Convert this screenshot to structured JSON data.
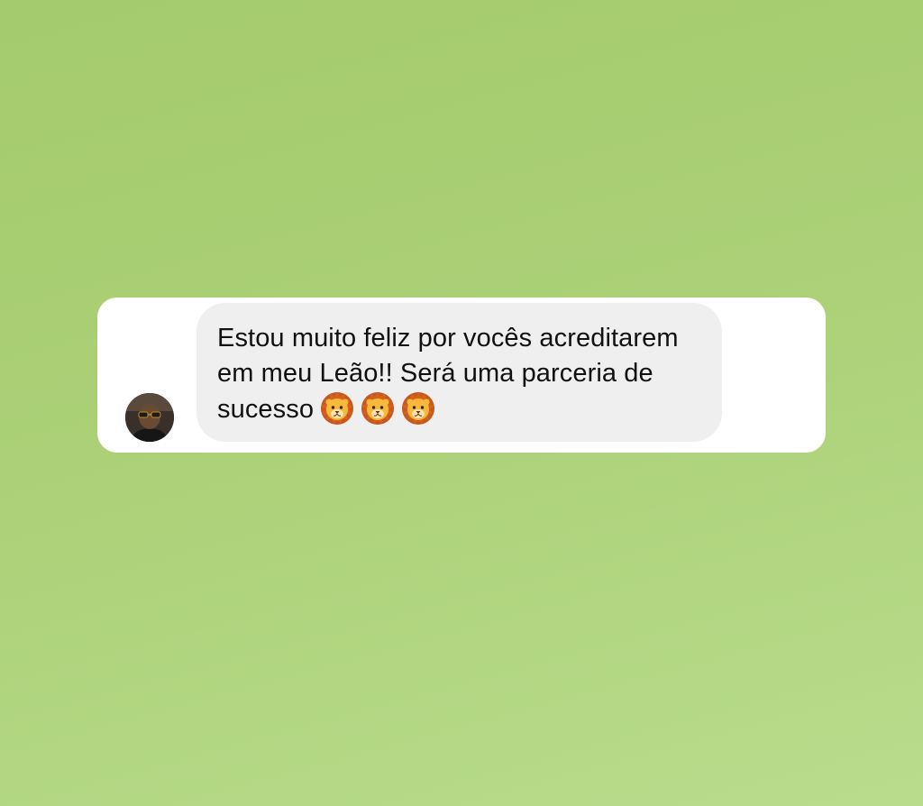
{
  "screen": {
    "background": "#abd077"
  },
  "comment": {
    "author_avatar": "user-avatar",
    "text": "Estou muito feliz por vocês acreditarem em meu Leão!! Será uma parceria de sucesso",
    "emojis": [
      "lion-face-icon",
      "lion-face-icon",
      "lion-face-icon"
    ],
    "bubble_color": "#efefef",
    "card_color": "#ffffff"
  }
}
